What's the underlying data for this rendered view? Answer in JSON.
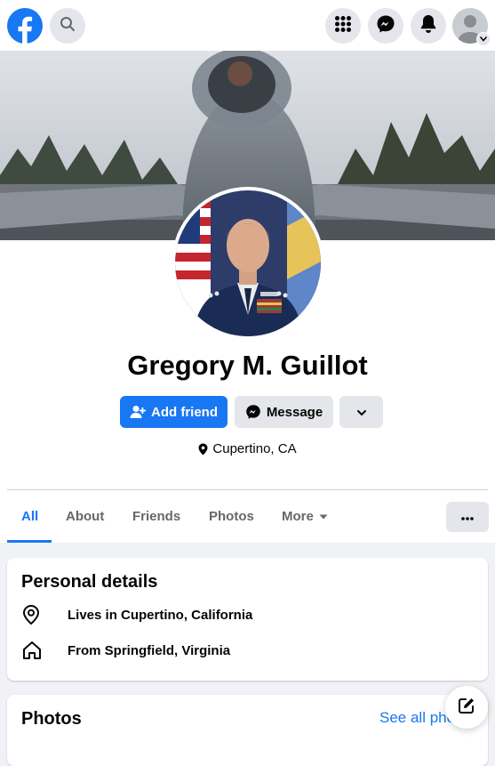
{
  "topbar": {
    "logo_icon": "facebook-logo-icon",
    "search_icon": "search-icon",
    "menu_icon": "grid-menu-icon",
    "messenger_icon": "messenger-icon",
    "notifications_icon": "bell-icon",
    "account_icon": "account-avatar-icon",
    "brand_color": "#1877f2"
  },
  "profile": {
    "name": "Gregory M. Guillot",
    "add_friend_label": "Add friend",
    "message_label": "Message",
    "location": "Cupertino, CA"
  },
  "tabs": [
    {
      "label": "All",
      "active": true
    },
    {
      "label": "About",
      "active": false
    },
    {
      "label": "Friends",
      "active": false
    },
    {
      "label": "Photos",
      "active": false
    },
    {
      "label": "More",
      "active": false
    }
  ],
  "details": {
    "title": "Personal details",
    "lives_in": "Lives in Cupertino, California",
    "from": "From Springfield, Virginia"
  },
  "photos": {
    "title": "Photos",
    "see_all_label": "See all photos"
  },
  "colors": {
    "accent": "#1877f2",
    "button_gray": "#e4e6eb",
    "page_bg": "#f0f2f5",
    "secondary_text": "#65676b"
  }
}
